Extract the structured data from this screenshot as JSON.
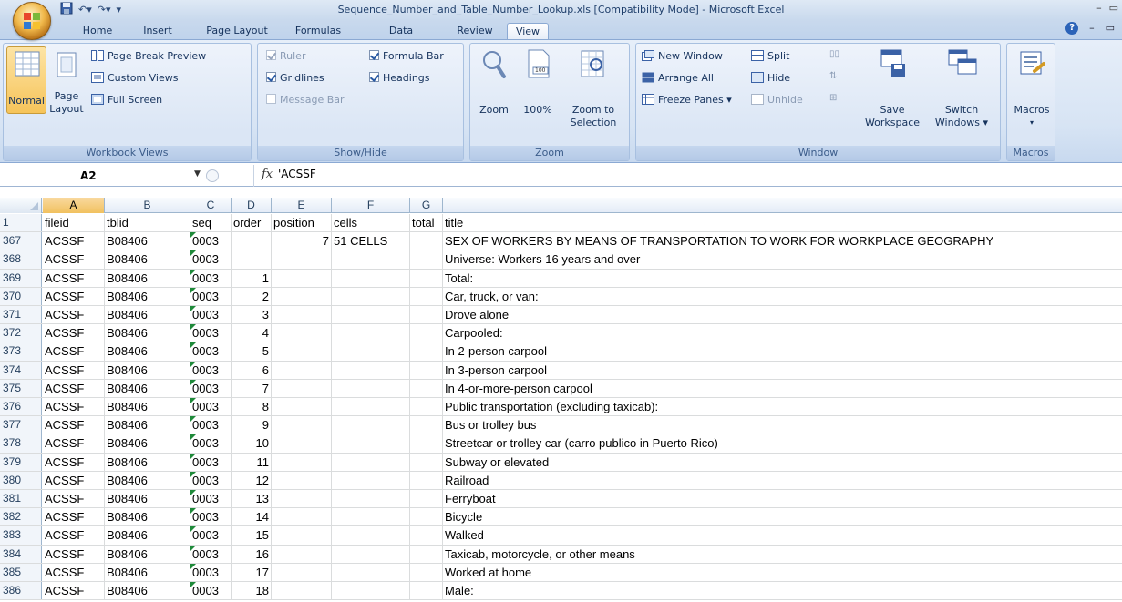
{
  "window": {
    "title": "Sequence_Number_and_Table_Number_Lookup.xls  [Compatibility Mode] - Microsoft Excel"
  },
  "tabs": [
    "Home",
    "Insert",
    "Page Layout",
    "Formulas",
    "Data",
    "Review",
    "View"
  ],
  "active_tab": "View",
  "ribbon": {
    "workbook_views": {
      "label": "Workbook Views",
      "normal": "Normal",
      "page_layout_1": "Page",
      "page_layout_2": "Layout",
      "page_break_preview": "Page Break Preview",
      "custom_views": "Custom Views",
      "full_screen": "Full Screen"
    },
    "show_hide": {
      "label": "Show/Hide",
      "ruler": "Ruler",
      "gridlines": "Gridlines",
      "message_bar": "Message Bar",
      "formula_bar": "Formula Bar",
      "headings": "Headings"
    },
    "zoom": {
      "label": "Zoom",
      "zoom": "Zoom",
      "hundred": "100%",
      "zoom_to_1": "Zoom to",
      "zoom_to_2": "Selection",
      "icon_text": "100"
    },
    "window": {
      "label": "Window",
      "new_window": "New Window",
      "arrange_all": "Arrange All",
      "freeze_panes": "Freeze Panes",
      "split": "Split",
      "hide": "Hide",
      "unhide": "Unhide",
      "save_1": "Save",
      "save_2": "Workspace",
      "switch_1": "Switch",
      "switch_2": "Windows"
    },
    "macros": {
      "label": "Macros",
      "macros": "Macros"
    }
  },
  "formula_bar": {
    "name_box": "A2",
    "fx": "fx",
    "formula": "'ACSSF"
  },
  "columns": [
    "A",
    "B",
    "C",
    "D",
    "E",
    "F",
    "G"
  ],
  "header_row": {
    "num": "1",
    "A": "fileid",
    "B": "tblid",
    "C": "seq",
    "D": "order",
    "E": "position",
    "F": "cells",
    "G": "total",
    "H": "title"
  },
  "rows": [
    {
      "num": "367",
      "A": "ACSSF",
      "B": "B08406",
      "C": "0003",
      "D": "",
      "E": "7",
      "F": "51 CELLS",
      "H": "SEX OF WORKERS BY MEANS OF TRANSPORTATION TO WORK FOR WORKPLACE GEOGRAPHY"
    },
    {
      "num": "368",
      "A": "ACSSF",
      "B": "B08406",
      "C": "0003",
      "D": "",
      "E": "",
      "F": "",
      "H": "Universe:  Workers 16 years and over"
    },
    {
      "num": "369",
      "A": "ACSSF",
      "B": "B08406",
      "C": "0003",
      "D": "1",
      "E": "",
      "F": "",
      "H": "Total:"
    },
    {
      "num": "370",
      "A": "ACSSF",
      "B": "B08406",
      "C": "0003",
      "D": "2",
      "E": "",
      "F": "",
      "H": "Car, truck, or van:"
    },
    {
      "num": "371",
      "A": "ACSSF",
      "B": "B08406",
      "C": "0003",
      "D": "3",
      "E": "",
      "F": "",
      "H": "Drove alone"
    },
    {
      "num": "372",
      "A": "ACSSF",
      "B": "B08406",
      "C": "0003",
      "D": "4",
      "E": "",
      "F": "",
      "H": "Carpooled:"
    },
    {
      "num": "373",
      "A": "ACSSF",
      "B": "B08406",
      "C": "0003",
      "D": "5",
      "E": "",
      "F": "",
      "H": "In 2-person carpool"
    },
    {
      "num": "374",
      "A": "ACSSF",
      "B": "B08406",
      "C": "0003",
      "D": "6",
      "E": "",
      "F": "",
      "H": "In 3-person carpool"
    },
    {
      "num": "375",
      "A": "ACSSF",
      "B": "B08406",
      "C": "0003",
      "D": "7",
      "E": "",
      "F": "",
      "H": "In 4-or-more-person carpool"
    },
    {
      "num": "376",
      "A": "ACSSF",
      "B": "B08406",
      "C": "0003",
      "D": "8",
      "E": "",
      "F": "",
      "H": "Public transportation (excluding taxicab):"
    },
    {
      "num": "377",
      "A": "ACSSF",
      "B": "B08406",
      "C": "0003",
      "D": "9",
      "E": "",
      "F": "",
      "H": "Bus or trolley bus"
    },
    {
      "num": "378",
      "A": "ACSSF",
      "B": "B08406",
      "C": "0003",
      "D": "10",
      "E": "",
      "F": "",
      "H": "Streetcar or trolley car (carro publico in Puerto Rico)"
    },
    {
      "num": "379",
      "A": "ACSSF",
      "B": "B08406",
      "C": "0003",
      "D": "11",
      "E": "",
      "F": "",
      "H": "Subway or elevated"
    },
    {
      "num": "380",
      "A": "ACSSF",
      "B": "B08406",
      "C": "0003",
      "D": "12",
      "E": "",
      "F": "",
      "H": "Railroad"
    },
    {
      "num": "381",
      "A": "ACSSF",
      "B": "B08406",
      "C": "0003",
      "D": "13",
      "E": "",
      "F": "",
      "H": "Ferryboat"
    },
    {
      "num": "382",
      "A": "ACSSF",
      "B": "B08406",
      "C": "0003",
      "D": "14",
      "E": "",
      "F": "",
      "H": "Bicycle"
    },
    {
      "num": "383",
      "A": "ACSSF",
      "B": "B08406",
      "C": "0003",
      "D": "15",
      "E": "",
      "F": "",
      "H": "Walked"
    },
    {
      "num": "384",
      "A": "ACSSF",
      "B": "B08406",
      "C": "0003",
      "D": "16",
      "E": "",
      "F": "",
      "H": "Taxicab, motorcycle, or other means"
    },
    {
      "num": "385",
      "A": "ACSSF",
      "B": "B08406",
      "C": "0003",
      "D": "17",
      "E": "",
      "F": "",
      "H": "Worked at home"
    },
    {
      "num": "386",
      "A": "ACSSF",
      "B": "B08406",
      "C": "0003",
      "D": "18",
      "E": "",
      "F": "",
      "H": "Male:"
    }
  ],
  "colors": {
    "ribbon_bg": "#d7e4f4",
    "selected_header": "#f1c15f",
    "text_triangle": "#1f8a3a"
  }
}
